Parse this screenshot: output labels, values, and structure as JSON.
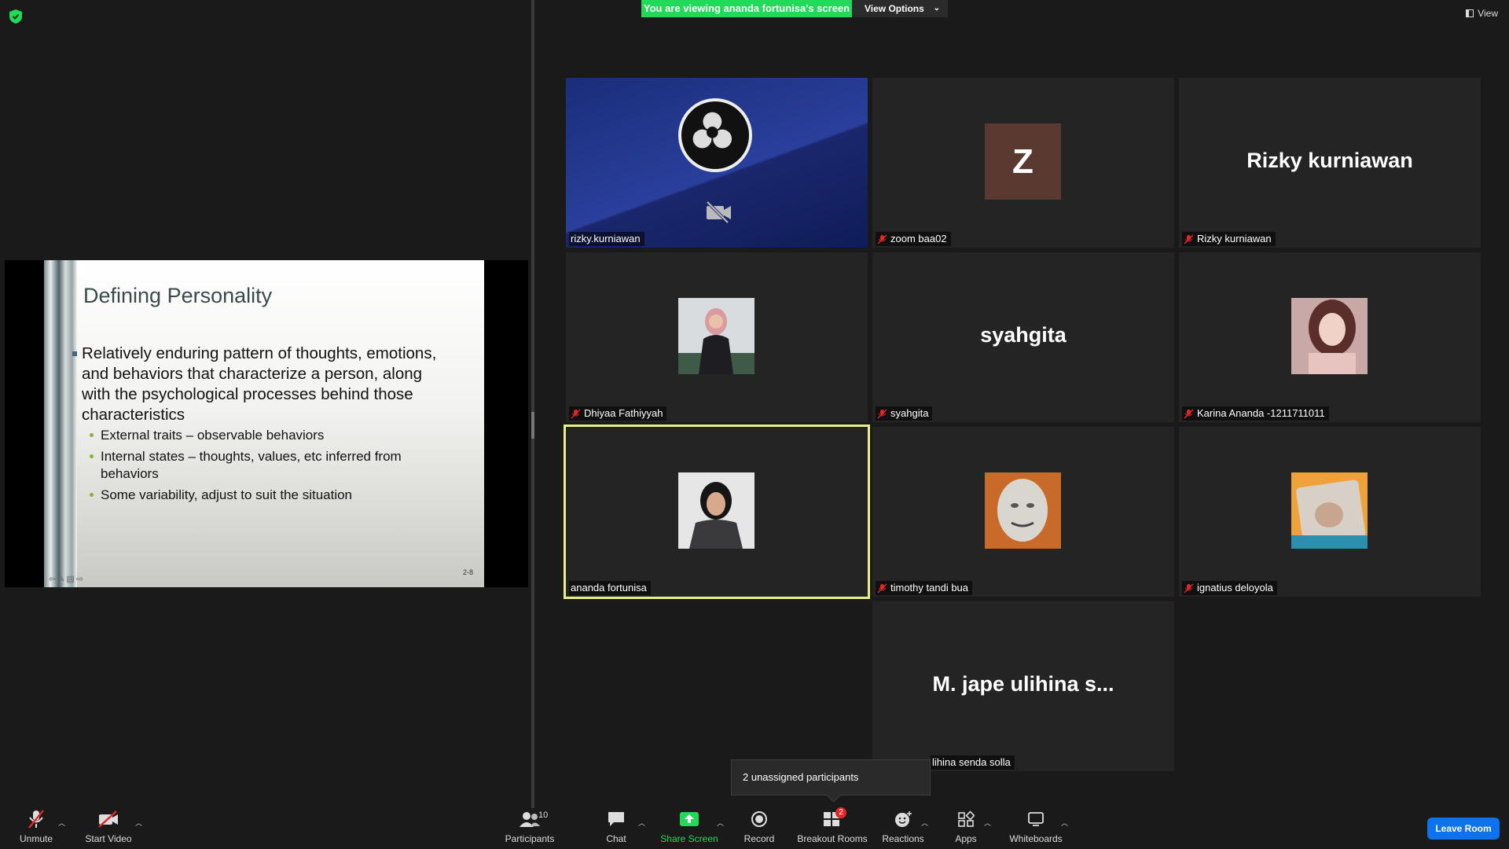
{
  "banner": {
    "text": "You are viewing ananda fortunisa's screen"
  },
  "view_options": {
    "label": "View Options"
  },
  "view_button": {
    "label": "View"
  },
  "slide": {
    "title": "Defining Personality",
    "bullet": "Relatively enduring pattern of thoughts, emotions, and behaviors that characterize a person, along with the psychological processes behind those characteristics",
    "subbullets": [
      "External traits – observable behaviors",
      "Internal states – thoughts, values, etc inferred from behaviors",
      "Some variability, adjust to suit the situation"
    ],
    "page_number": "2-8"
  },
  "participants_tiles": [
    {
      "name": "rizky.kurniawan",
      "muted": false,
      "display": "obs"
    },
    {
      "name": "zoom baa02",
      "muted": true,
      "display": "initial",
      "initial": "Z"
    },
    {
      "name": "Rizky kurniawan",
      "muted": true,
      "display": "name",
      "big_name": "Rizky kurniawan"
    },
    {
      "name": "Dhiyaa Fathiyyah",
      "muted": true,
      "display": "photo"
    },
    {
      "name": "syahgita",
      "muted": true,
      "display": "name",
      "big_name": "syahgita"
    },
    {
      "name": "Karina Ananda -1211711011",
      "muted": true,
      "display": "photo"
    },
    {
      "name": "ananda fortunisa",
      "muted": false,
      "display": "photo",
      "active": true
    },
    {
      "name": "timothy tandi bua",
      "muted": true,
      "display": "photo"
    },
    {
      "name": "ignatius deloyola",
      "muted": true,
      "display": "photo"
    },
    {
      "name": "lihina senda solla",
      "muted": false,
      "display": "name",
      "big_name": "M. jape ulihina s..."
    }
  ],
  "tooltip": {
    "text": "2 unassigned participants"
  },
  "toolbar": {
    "unmute": "Unmute",
    "start_video": "Start Video",
    "participants": "Participants",
    "participants_count": "10",
    "chat": "Chat",
    "share_screen": "Share Screen",
    "record": "Record",
    "breakout_rooms": "Breakout Rooms",
    "breakout_badge": "2",
    "reactions": "Reactions",
    "apps": "Apps",
    "whiteboards": "Whiteboards",
    "leave_room": "Leave Room"
  },
  "colors": {
    "accent_green": "#23d959",
    "active_speaker": "#e6ef8a",
    "leave_blue": "#0e72ed",
    "badge_red": "#e02828"
  }
}
